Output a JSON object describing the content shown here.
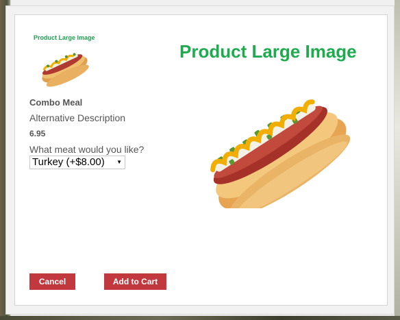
{
  "product": {
    "thumb_caption": "Product Large Image",
    "large_title": "Product Large Image",
    "name": "Combo Meal",
    "description": "Alternative Description",
    "price": "6.95"
  },
  "options": {
    "question": "What meat would you like?",
    "selected": "Turkey (+$8.00)"
  },
  "buttons": {
    "cancel": "Cancel",
    "add_to_cart": "Add to Cart"
  },
  "colors": {
    "accent_green": "#1eab4e",
    "button_red": "#c1393f"
  }
}
